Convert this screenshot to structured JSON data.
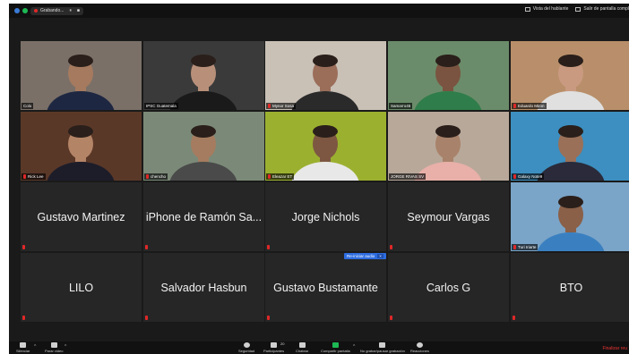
{
  "topbar": {
    "recording_label": "Grabando...",
    "pause_symbol": "⏸",
    "stop_symbol": "■",
    "speaker_view_label": "Vista del hablante",
    "fullscreen_label": "Salir de pantalla compl"
  },
  "tiles": [
    {
      "name": "Colo",
      "type": "video",
      "active": true,
      "bg": "#7a7068",
      "face": "#a57a5f",
      "shirt": "#1e2742"
    },
    {
      "name": "IPSC Guatemala",
      "type": "video",
      "muted": false,
      "bg": "#3a3a3a",
      "face": "#b8907a",
      "shirt": "#1a1a1a"
    },
    {
      "name": "Mynor Sosa",
      "type": "video",
      "muted": true,
      "bg": "#c9c0b6",
      "face": "#9b6e5a",
      "shirt": "#2a2a2a"
    },
    {
      "name": "Samarro45",
      "type": "video",
      "muted": false,
      "bg": "#6b8c6a",
      "face": "#7a5440",
      "shirt": "#2f7d4a"
    },
    {
      "name": "Eduardo Miron",
      "type": "video",
      "muted": true,
      "bg": "#b88f6a",
      "face": "#c99a80",
      "shirt": "#e0e0e0"
    },
    {
      "name": "Rick Lee",
      "type": "video",
      "muted": true,
      "bg": "#5a3828",
      "face": "#b48467",
      "shirt": "#1d1d2a"
    },
    {
      "name": "chencho",
      "type": "video",
      "muted": true,
      "bg": "#7b8a78",
      "face": "#a57c60",
      "shirt": "#4a4a4a"
    },
    {
      "name": "Eleazar ET",
      "type": "video",
      "muted": true,
      "bg": "#9cb030",
      "face": "#7d5742",
      "shirt": "#e8e8e8"
    },
    {
      "name": "JORGE RIVAS SV",
      "type": "video",
      "muted": false,
      "bg": "#b8a89a",
      "face": "#a8826a",
      "shirt": "#e8b0a8"
    },
    {
      "name": "Galaxy Note9",
      "type": "video",
      "muted": true,
      "bg": "#3c8fc0",
      "face": "#9a7058",
      "shirt": "#2a2a3a"
    },
    {
      "name": "Gustavo Martinez",
      "type": "name"
    },
    {
      "name": "iPhone de Ramón Sa...",
      "type": "name"
    },
    {
      "name": "Jorge Nichols",
      "type": "name"
    },
    {
      "name": "Seymour Vargas",
      "type": "name"
    },
    {
      "name": "Turi Iriarte",
      "type": "video",
      "muted": true,
      "bg": "#7aa4c8",
      "face": "#8a6048",
      "shirt": "#3a80c0"
    },
    {
      "name": "LILO",
      "type": "name"
    },
    {
      "name": "Salvador Hasbun",
      "type": "name"
    },
    {
      "name": "Gustavo Bustamante",
      "type": "name"
    },
    {
      "name": "Carlos G",
      "type": "name"
    },
    {
      "name": "BTO",
      "type": "name"
    }
  ],
  "reaudio": {
    "label": "Re-iniciar audio",
    "close": "×"
  },
  "toolbar": {
    "mute_label": "Silenciar",
    "video_label": "Parar video",
    "security_label": "Seguridad",
    "participants_label": "Participantes",
    "participants_count": "20",
    "chat_label": "Chatear",
    "share_label": "Compartir pantalla",
    "record_label": "No grabar/pausar grabación",
    "reactions_label": "Reacciones",
    "end_label": "Finalizar reu"
  },
  "colors": {
    "active_border": "#c8e000",
    "mute_red": "#e02828",
    "share_green": "#1db954",
    "reaudio_blue": "#2d6ce0"
  }
}
